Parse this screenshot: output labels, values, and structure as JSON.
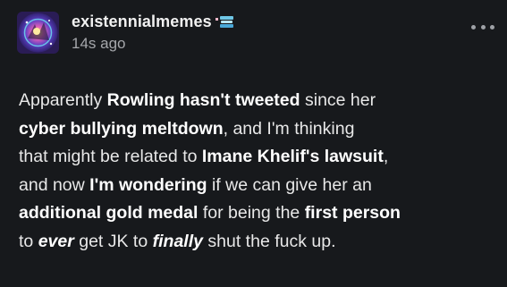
{
  "post": {
    "username": "existennialmemes",
    "timestamp": "14s ago",
    "avatar_icon": "cosmic-avatar-icon",
    "badge_icon": "badge-icon",
    "more_icon": "more-options-icon",
    "colors": {
      "background": "#17191c",
      "text": "#e8e8e8",
      "muted": "#a5a7ab"
    },
    "lines": [
      [
        {
          "t": "Apparently ",
          "s": "n"
        },
        {
          "t": "Rowling hasn't tweeted",
          "s": "b"
        },
        {
          "t": " since her",
          "s": "n"
        }
      ],
      [
        {
          "t": "cyber bullying meltdown",
          "s": "b"
        },
        {
          "t": ", and I'm thinking",
          "s": "n"
        }
      ],
      [
        {
          "t": "that might be related to ",
          "s": "n"
        },
        {
          "t": "Imane Khelif's lawsuit",
          "s": "b"
        },
        {
          "t": ",",
          "s": "n"
        }
      ],
      [
        {
          "t": "and now ",
          "s": "n"
        },
        {
          "t": "I'm wondering",
          "s": "b"
        },
        {
          "t": " if we can give her an",
          "s": "n"
        }
      ],
      [
        {
          "t": "additional gold medal",
          "s": "b"
        },
        {
          "t": " for being the ",
          "s": "n"
        },
        {
          "t": "first person",
          "s": "b"
        }
      ],
      [
        {
          "t": "to ",
          "s": "n"
        },
        {
          "t": "ever",
          "s": "bi"
        },
        {
          "t": " get JK to ",
          "s": "n"
        },
        {
          "t": "finally",
          "s": "bi"
        },
        {
          "t": " shut the fuck up.",
          "s": "n"
        }
      ]
    ]
  }
}
